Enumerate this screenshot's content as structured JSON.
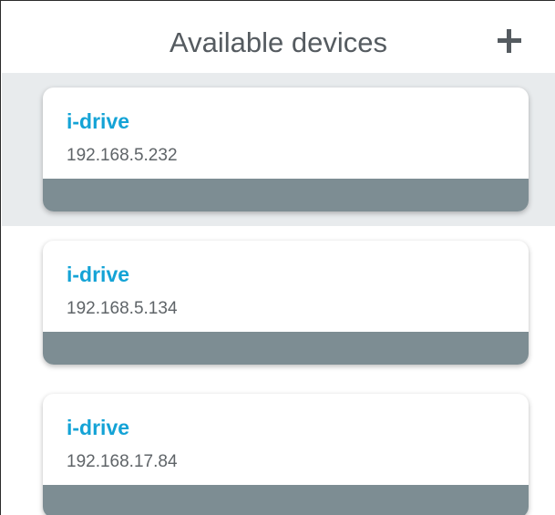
{
  "header": {
    "title": "Available devices",
    "add_icon": "plus-icon"
  },
  "devices": [
    {
      "name": "i-drive",
      "ip": "192.168.5.232",
      "selected": true
    },
    {
      "name": "i-drive",
      "ip": "192.168.5.134",
      "selected": false
    },
    {
      "name": "i-drive",
      "ip": "192.168.17.84",
      "selected": false
    }
  ],
  "colors": {
    "title": "#555b60",
    "device_name": "#14a3d6",
    "device_ip": "#5f6468",
    "card_bar": "#7d8d93",
    "selected_row_bg": "#e8ebed"
  }
}
